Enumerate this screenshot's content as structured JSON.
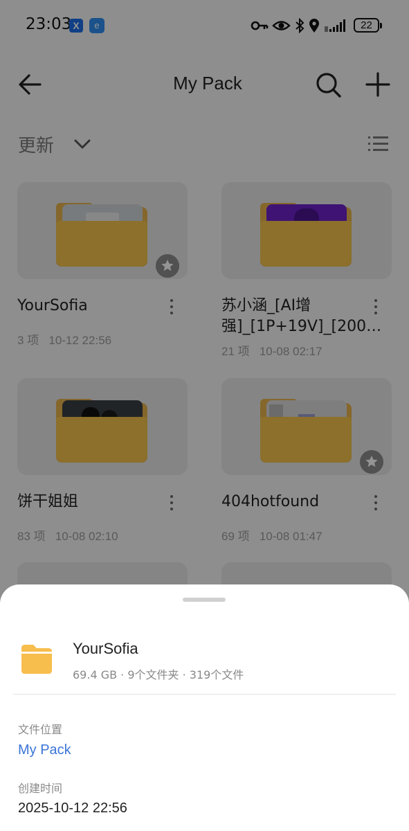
{
  "status_bar": {
    "time": "23:03",
    "notification_icons": [
      "x-app-icon",
      "browser-app-icon"
    ],
    "system_icons": [
      "key-icon",
      "eye-icon",
      "bluetooth-icon",
      "location-icon",
      "signal-icon"
    ],
    "battery_level": "22"
  },
  "header": {
    "title": "My Pack",
    "back_icon": "back-arrow-icon",
    "search_icon": "search-icon",
    "add_icon": "plus-icon"
  },
  "sort": {
    "label": "更新",
    "view_icon": "list-view-icon"
  },
  "folders": [
    {
      "name": "YourSofia",
      "count": "3 项",
      "date": "10-12 22:56",
      "starred": true
    },
    {
      "name": "苏小涵_[AI增强]_[1P+19V]_[200…",
      "count": "21 项",
      "date": "10-08 02:17",
      "starred": false
    },
    {
      "name": "饼干姐姐",
      "count": "83 项",
      "date": "10-08 02:10",
      "starred": false
    },
    {
      "name": "404hotfound",
      "count": "69 项",
      "date": "10-08 01:47",
      "starred": true
    }
  ],
  "details": {
    "name": "YourSofia",
    "meta": "69.4 GB · 9个文件夹 · 319个文件",
    "location_label": "文件位置",
    "location_value": "My Pack",
    "created_label": "创建时间",
    "created_value": "2025-10-12 22:56"
  },
  "colors": {
    "folder_front": "#f2c24a",
    "folder_back": "#e6b24c",
    "link": "#3a74d6",
    "sheet_icon": "#f7bd4d"
  }
}
